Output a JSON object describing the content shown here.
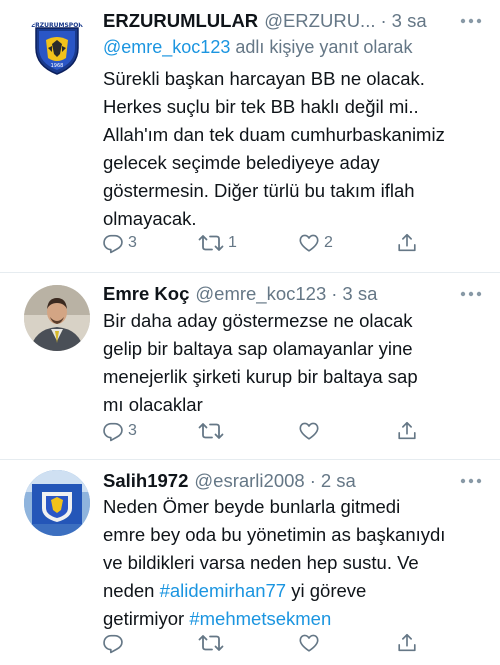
{
  "tweets": [
    {
      "name": "ERZURUMLULAR",
      "handle": "@ERZURU...",
      "dot": "·",
      "time": "3 sa",
      "reply_mention": "@emre_koc123",
      "reply_suffix": "adlı kişiye yanıt olarak",
      "lines": [
        "Sürekli başkan harcayan BB ne olacak.",
        "Herkes suçlu bir tek BB haklı değil mi..",
        "Allah'ım dan tek duam cumhurbaskanimiz",
        "gelecek seçimde belediyeye aday",
        "göstermesin. Diğer türlü bu takım iflah",
        "olmayacak."
      ],
      "avatar_text": "ERZURUMSPOR",
      "avatar_year": "1968",
      "counts": {
        "reply": "3",
        "retweet": "1",
        "like": "2"
      }
    },
    {
      "name": "Emre Koç",
      "handle": "@emre_koc123",
      "dot": "·",
      "time": "3 sa",
      "lines": [
        "Bir daha aday göstermezse ne olacak",
        "gelip bir baltaya sap olamayanlar yine",
        "menejerlik şirketi kurup  bir baltaya sap",
        "mı olacaklar"
      ],
      "counts": {
        "reply": "3",
        "retweet": "",
        "like": ""
      }
    },
    {
      "name": "Salih1972",
      "handle": "@esrarli2008",
      "dot": "·",
      "time": "2 sa",
      "lines": [
        "Neden Ömer beyde bunlarla gitmedi",
        "emre bey oda bu yönetimin as başkanıydı",
        "ve bildikleri varsa neden hep sustu. Ve"
      ],
      "line4_prefix": "neden ",
      "line4_hashtag": "#alidemirhan77",
      "line4_suffix": " yi göreve",
      "line5_prefix": "getirmiyor ",
      "line5_hashtag": "#mehmetsekmen",
      "counts": {
        "reply": "",
        "retweet": "",
        "like": ""
      }
    }
  ],
  "icons": {
    "reply": "reply-icon",
    "retweet": "retweet-icon",
    "like": "like-icon",
    "share": "share-icon",
    "more": "more-icon"
  },
  "colors": {
    "link": "#1b95e0",
    "muted": "#657786",
    "divider": "#e6ecf0"
  }
}
